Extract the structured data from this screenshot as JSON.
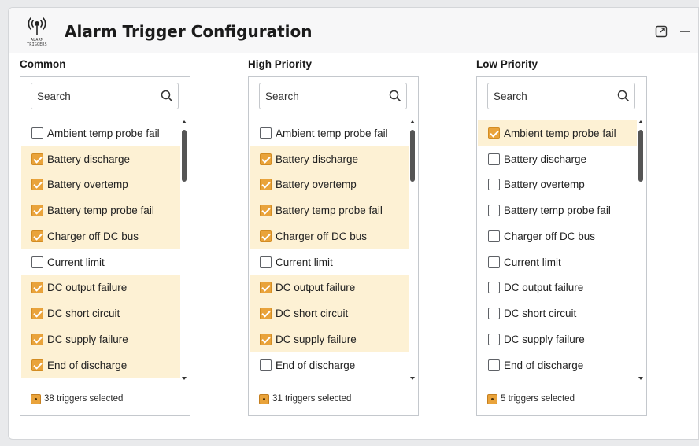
{
  "app": {
    "title": "Alarm Trigger Configuration",
    "logo_text": [
      "ALARM",
      "TRIGGERS"
    ]
  },
  "colors": {
    "accent": "#e9a33b",
    "selected_row": "#fdf1d4"
  },
  "window_controls": [
    {
      "name": "expand-button",
      "icon": "expand-icon"
    },
    {
      "name": "minimize-button",
      "icon": "minimize-icon"
    }
  ],
  "columns": [
    {
      "title": "Common",
      "search_placeholder": "Search",
      "items": [
        {
          "label": "Ambient temp probe fail",
          "checked": false
        },
        {
          "label": "Battery discharge",
          "checked": true
        },
        {
          "label": "Battery overtemp",
          "checked": true
        },
        {
          "label": "Battery temp probe fail",
          "checked": true
        },
        {
          "label": "Charger off DC bus",
          "checked": true
        },
        {
          "label": "Current limit",
          "checked": false
        },
        {
          "label": "DC output failure",
          "checked": true
        },
        {
          "label": "DC short circuit",
          "checked": true
        },
        {
          "label": "DC supply failure",
          "checked": true
        },
        {
          "label": "End of discharge",
          "checked": true
        }
      ],
      "footer": "38 triggers selected"
    },
    {
      "title": "High Priority",
      "search_placeholder": "Search",
      "items": [
        {
          "label": "Ambient temp probe fail",
          "checked": false
        },
        {
          "label": "Battery discharge",
          "checked": true
        },
        {
          "label": "Battery overtemp",
          "checked": true
        },
        {
          "label": "Battery temp probe fail",
          "checked": true
        },
        {
          "label": "Charger off DC bus",
          "checked": true
        },
        {
          "label": "Current limit",
          "checked": false
        },
        {
          "label": "DC output failure",
          "checked": true
        },
        {
          "label": "DC short circuit",
          "checked": true
        },
        {
          "label": "DC supply failure",
          "checked": true
        },
        {
          "label": "End of discharge",
          "checked": false
        }
      ],
      "footer": "31 triggers selected"
    },
    {
      "title": "Low Priority",
      "search_placeholder": "Search",
      "items": [
        {
          "label": "Ambient temp probe fail",
          "checked": true
        },
        {
          "label": "Battery discharge",
          "checked": false
        },
        {
          "label": "Battery overtemp",
          "checked": false
        },
        {
          "label": "Battery temp probe fail",
          "checked": false
        },
        {
          "label": "Charger off DC bus",
          "checked": false
        },
        {
          "label": "Current limit",
          "checked": false
        },
        {
          "label": "DC output failure",
          "checked": false
        },
        {
          "label": "DC short circuit",
          "checked": false
        },
        {
          "label": "DC supply failure",
          "checked": false
        },
        {
          "label": "End of discharge",
          "checked": false
        }
      ],
      "footer": "5 triggers selected"
    }
  ]
}
